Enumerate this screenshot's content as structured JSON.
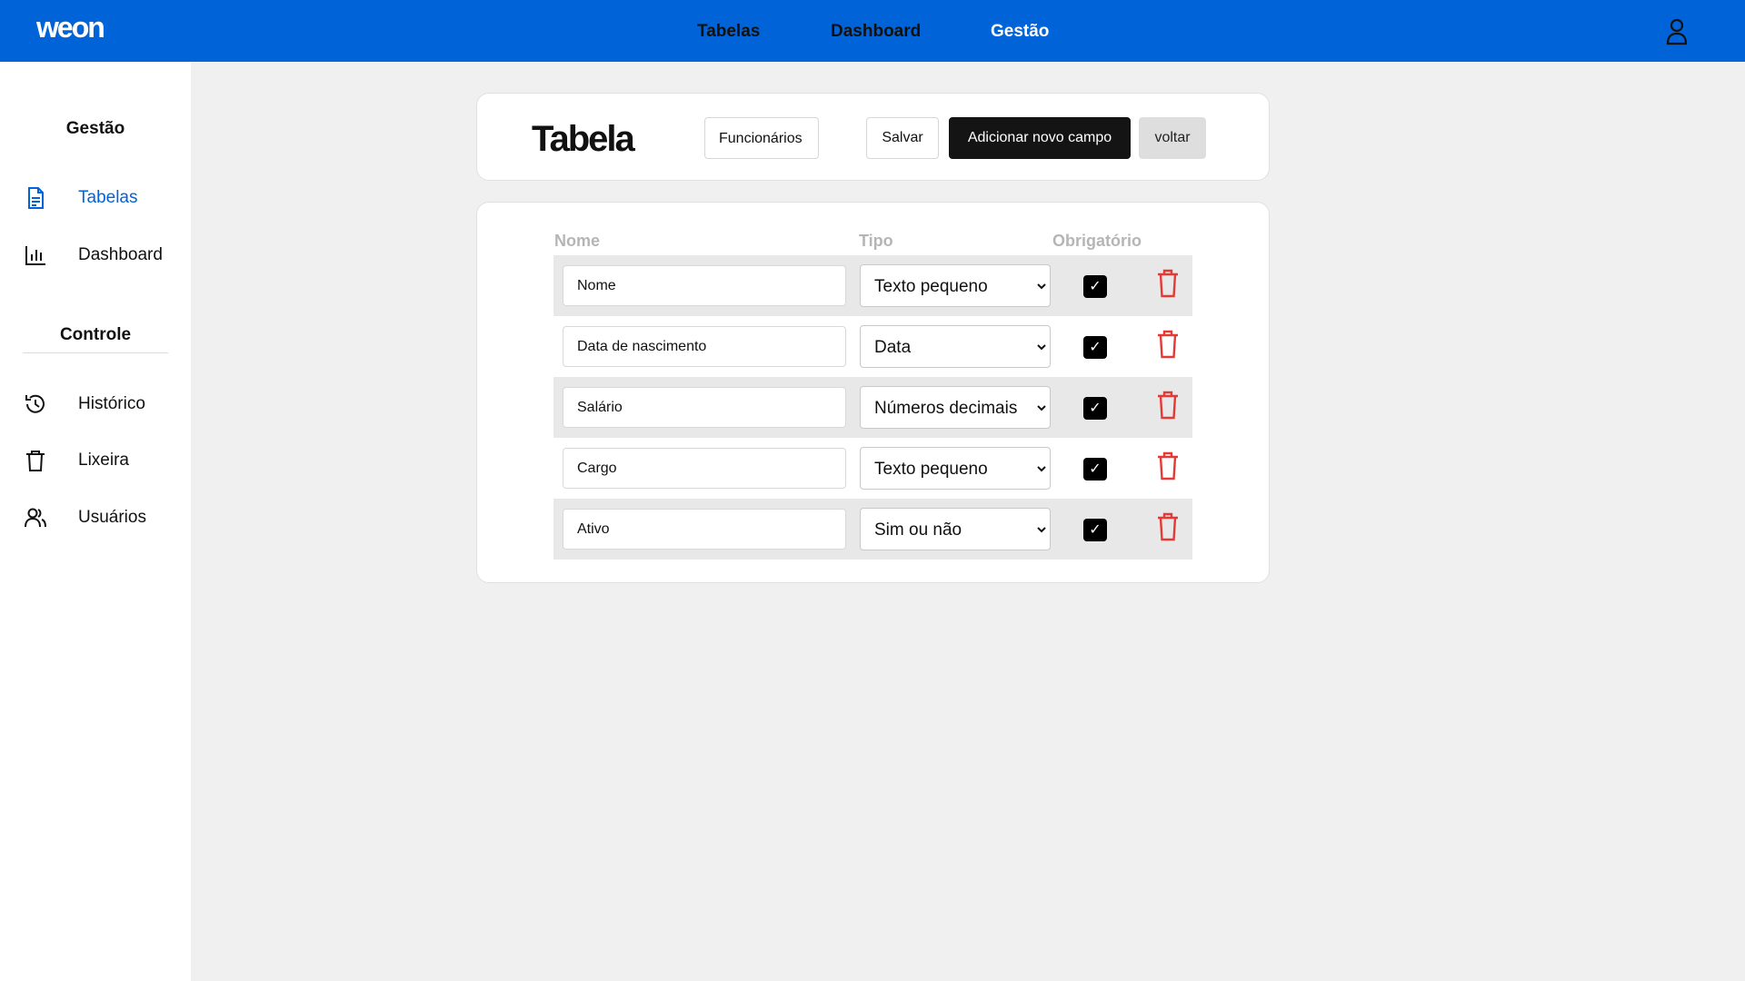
{
  "app": {
    "logo": "weon"
  },
  "topnav": {
    "items": [
      "Tabelas",
      "Dashboard",
      "Gestão"
    ]
  },
  "sidebar": {
    "section1": "Gestão",
    "items1": [
      {
        "label": "Tabelas",
        "icon": "document-icon",
        "active": true
      },
      {
        "label": "Dashboard",
        "icon": "bar-chart-icon",
        "active": false
      }
    ],
    "section2": "Controle",
    "items2": [
      {
        "label": "Histórico",
        "icon": "history-icon"
      },
      {
        "label": "Lixeira",
        "icon": "trash-icon"
      },
      {
        "label": "Usuários",
        "icon": "users-icon"
      }
    ]
  },
  "header": {
    "title": "Tabela",
    "table_name": "Funcionários",
    "save_label": "Salvar",
    "add_label": "Adicionar novo campo",
    "back_label": "voltar"
  },
  "fields": {
    "columns": {
      "name": "Nome",
      "type": "Tipo",
      "required": "Obrigatório"
    },
    "rows": [
      {
        "name": "Nome",
        "type": "Texto pequeno",
        "required": true
      },
      {
        "name": "Data de nascimento",
        "type": "Data",
        "required": true
      },
      {
        "name": "Salário",
        "type": "Números decimais",
        "required": true
      },
      {
        "name": "Cargo",
        "type": "Texto pequeno",
        "required": true
      },
      {
        "name": "Ativo",
        "type": "Sim ou não",
        "required": true
      }
    ]
  },
  "colors": {
    "brand": "#0063d8",
    "danger": "#e53935",
    "dark_button": "#141414"
  }
}
